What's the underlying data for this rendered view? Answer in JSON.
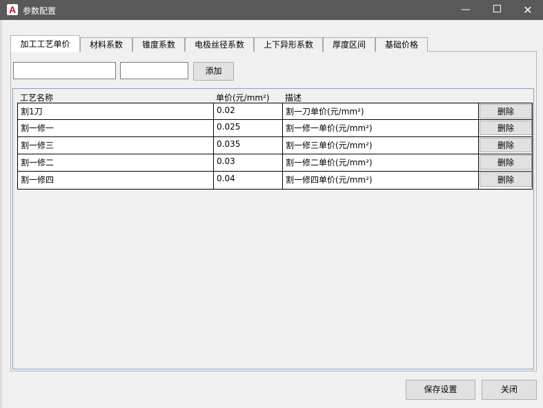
{
  "window": {
    "title": "参数配置",
    "app_icon_letter": "A",
    "minimize_glyph": "—",
    "close_glyph": "✕"
  },
  "tabs": [
    {
      "label": "加工工艺单价",
      "active": true
    },
    {
      "label": "材料系数",
      "active": false
    },
    {
      "label": "锥度系数",
      "active": false
    },
    {
      "label": "电极丝径系数",
      "active": false
    },
    {
      "label": "上下异形系数",
      "active": false
    },
    {
      "label": "厚度区间",
      "active": false
    },
    {
      "label": "基础价格",
      "active": false
    }
  ],
  "form": {
    "input1_value": "",
    "input2_value": "",
    "add_label": "添加"
  },
  "table": {
    "headers": [
      "工艺名称",
      "单价(元/mm²)",
      "描述"
    ],
    "rows": [
      {
        "name": "割1刀",
        "price": "0.02",
        "desc": "割一刀单价(元/mm²)",
        "action": "删除"
      },
      {
        "name": "割一修一",
        "price": "0.025",
        "desc": "割一修一单价(元/mm²)",
        "action": "删除"
      },
      {
        "name": "割一修三",
        "price": "0.035",
        "desc": "割一修三单价(元/mm²)",
        "action": "删除"
      },
      {
        "name": "割一修二",
        "price": "0.03",
        "desc": "割一修二单价(元/mm²)",
        "action": "删除"
      },
      {
        "name": "割一修四",
        "price": "0.04",
        "desc": "割一修四单价(元/mm²)",
        "action": "删除"
      }
    ]
  },
  "footer": {
    "save_label": "保存设置",
    "close_label": "关闭"
  },
  "colors": {
    "titlebar": "#595959",
    "brand": "#c8102e",
    "grid_border": "#7fa2c8"
  }
}
